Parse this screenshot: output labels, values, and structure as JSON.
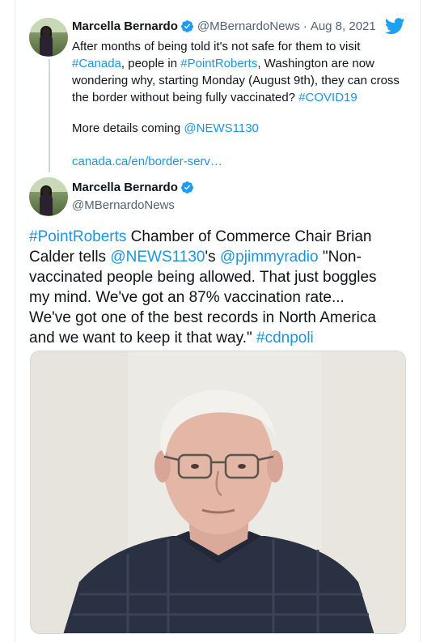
{
  "quoted_tweet": {
    "author_name": "Marcella Bernardo",
    "author_handle": "@MBernardoNews",
    "separator": "·",
    "date": "Aug 8, 2021",
    "text_lines": [
      [
        {
          "t": "After months of being told it's not safe for them to visit",
          "link": false
        }
      ],
      [
        {
          "t": "#Canada",
          "link": true
        },
        {
          "t": ", people in ",
          "link": false
        },
        {
          "t": "#PointRoberts",
          "link": true
        },
        {
          "t": ", Washington are now",
          "link": false
        }
      ],
      [
        {
          "t": "wondering why, starting Monday (August 9th), they can cross",
          "link": false
        }
      ],
      [
        {
          "t": "the border without being fully vaccinated?  ",
          "link": false
        },
        {
          "t": "#COVID19",
          "link": true
        }
      ]
    ],
    "details_prefix": "More details coming ",
    "details_mention": "@NEWS1130",
    "url_text": "canada.ca/en/border-serv…"
  },
  "main_tweet": {
    "author_name": "Marcella Bernardo",
    "author_handle": "@MBernardoNews",
    "text_lines": [
      [
        {
          "t": "#PointRoberts",
          "link": true
        },
        {
          "t": " Chamber of Commerce Chair Brian",
          "link": false
        }
      ],
      [
        {
          "t": "Calder tells ",
          "link": false
        },
        {
          "t": "@NEWS1130",
          "link": true
        },
        {
          "t": "'s ",
          "link": false
        },
        {
          "t": "@pjimmyradio",
          "link": true
        },
        {
          "t": " \"Non-",
          "link": false
        }
      ],
      [
        {
          "t": "vaccinated people being allowed. That just boggles",
          "link": false
        }
      ],
      [
        {
          "t": "my mind.  We've got an 87% vaccination rate...",
          "link": false
        }
      ],
      [
        {
          "t": "We've got one of the best records in North America",
          "link": false
        }
      ],
      [
        {
          "t": "and we want to keep it that way.\" ",
          "link": false
        },
        {
          "t": "#cdnpoli",
          "link": true
        }
      ]
    ]
  },
  "colors": {
    "link": "#1b95e0",
    "verified": "#1d9bf0",
    "twitter_blue": "#1da1f2",
    "muted": "#536471"
  },
  "icons": {
    "logo": "twitter-bird-icon",
    "verified": "verified-badge-icon"
  }
}
